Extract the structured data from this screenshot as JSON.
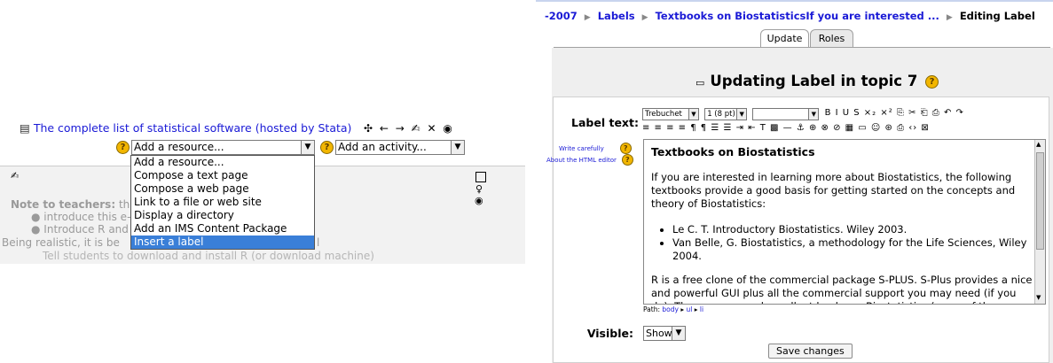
{
  "left": {
    "resource_link": "The complete list of statistical software (hosted by Stata)",
    "resource_tools": "✣ ← → ✍ ✕ ◉",
    "add_resource_select": "Add a resource...",
    "add_activity_select": "Add an activity...",
    "dropdown_options": [
      "Add a resource...",
      "Compose a text page",
      "Compose a web page",
      "Link to a file or web site",
      "Display a directory",
      "Add an IMS Content Package",
      "Insert a label"
    ],
    "selected_option": "Insert a label",
    "note_label": "Note to teachers:",
    "note_frag": "th",
    "bullet_1": "introduce this e-",
    "bullet_2": "Introduce R and",
    "realistic_text": "Being realistic, it is be",
    "realistic_tail": "l",
    "tell_students": "Tell students to download and install R (or download machine)"
  },
  "right": {
    "breadcrumb": {
      "prefix": "-2007",
      "items": [
        "Labels",
        "Textbooks on BiostatisticsIf you are interested ...",
        "Editing Label"
      ]
    },
    "tabs": [
      "Update",
      "Roles"
    ],
    "heading": "Updating Label in topic 7",
    "label_text_label": "Label text:",
    "write_carefully": "Write carefully",
    "about_editor": "About the HTML editor",
    "toolbar": {
      "font": "Trebuchet",
      "size": "1 (8 pt)",
      "row1": "B I U S  ×₂ ×²  ⎘ ✂ ⎗ ⎙  ↶ ↷",
      "row2": "≡ ≡ ≡ ≡  ¶ ¶  ☰ ☰ ⇥ ⇤  T ▩  — ⚓ ⊕ ⊗ ⊘  ▦ ▭ ☺ ⊛ ⎙  ‹› ⊠"
    },
    "editor": {
      "title": "Textbooks on Biostatistics",
      "intro": "If you are interested in learning more about Biostatistics, the following textbooks provide a good basis for getting started on the concepts and theory of Biostatistics:",
      "books": [
        "Le C. T. Introductory Biostatistics. Wiley 2003.",
        "Van Belle, G. Biostatistics, a methodology for the Life Sciences, Wiley 2004."
      ],
      "r_text": "R is a free clone of the commercial package S-PLUS. S-Plus provides a nice and powerful GUI plus all the commercial support you may need (if you do). There are several excellent books on Biostatistics (some of the previous S-PLUS)"
    },
    "path_label": "Path:",
    "path_items": [
      "body",
      "ul",
      "li"
    ],
    "visible_label": "Visible:",
    "visible_value": "Show",
    "save_button": "Save changes"
  }
}
